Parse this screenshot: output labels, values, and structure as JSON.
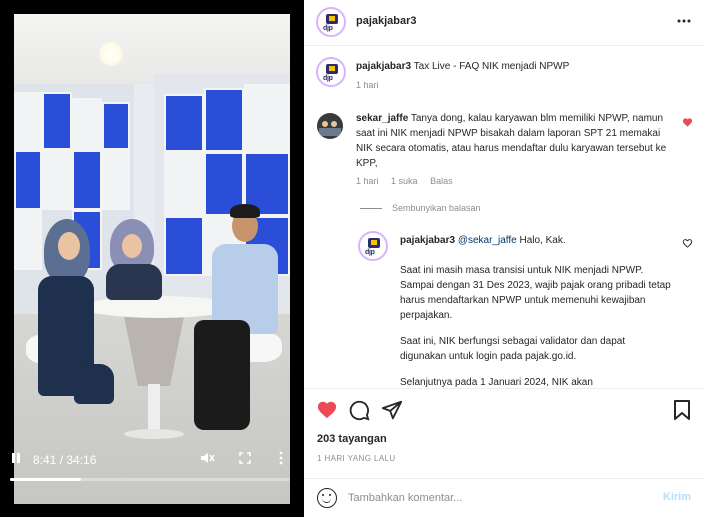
{
  "video": {
    "current_time": "8:41",
    "duration": "34:16",
    "progress": 0.253
  },
  "post": {
    "author": "pajakjabar3",
    "avatar_label": "djp",
    "caption_author": "pajakjabar3",
    "caption_text": "Tax Live - FAQ NIK menjadi NPWP",
    "caption_time": "1 hari"
  },
  "comment": {
    "author": "sekar_jaffe",
    "text": "Tanya dong, kalau karyawan blm memiliki NPWP, namun saat ini NIK menjadi NPWP bisakah dalam laporan SPT 21 memakai NIK secara otomatis, atau harus mendaftar dulu karyawan tersebut ke KPP,",
    "time": "1 hari",
    "likes": "1 suka",
    "reply_label": "Balas",
    "hide_replies": "Sembunyikan balasan"
  },
  "reply": {
    "author": "pajakjabar3",
    "mention": "@sekar_jaffe",
    "greeting": "Halo, Kak.",
    "p1": "Saat ini masih masa transisi untuk NIK menjadi NPWP. Sampai dengan 31 Des 2023, wajib pajak orang pribadi tetap harus mendaftarkan NPWP untuk memenuhi kewajiban perpajakan.",
    "p2": "Saat ini, NIK berfungsi sebagai validator dan dapat digunakan untuk login pada pajak.go.id.",
    "p3": "Selanjutnya pada 1 Januari 2024, NIK akan"
  },
  "stats": {
    "views": "203 tayangan",
    "ago": "1 HARI YANG LALU"
  },
  "composer": {
    "placeholder": "Tambahkan komentar...",
    "post_label": "Kirim"
  },
  "colors": {
    "like_red": "#ed4956",
    "post_disabled": "#b2dffc",
    "shelf_blue": "#2a4ed8"
  }
}
